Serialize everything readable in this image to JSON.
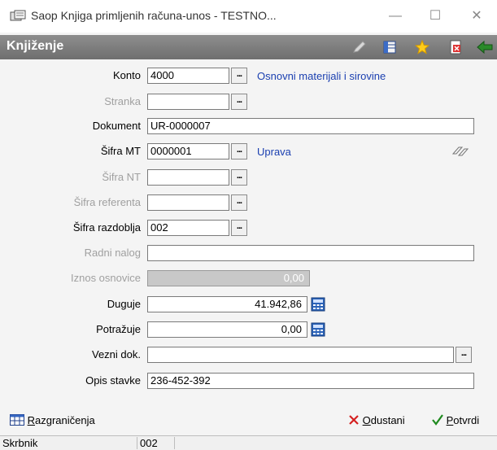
{
  "window": {
    "title": "Saop Knjiga primljenih računa-unos - TESTNO...",
    "minimize": "—",
    "maximize": "☐",
    "close": "✕"
  },
  "header": {
    "title": "Knjiženje"
  },
  "form": {
    "konto": {
      "label": "Konto",
      "value": "4000",
      "desc": "Osnovni materijali i sirovine"
    },
    "stranka": {
      "label": "Stranka",
      "value": ""
    },
    "dokument": {
      "label": "Dokument",
      "value": "UR-0000007"
    },
    "sifra_mt": {
      "label": "Šifra MT",
      "value": "0000001",
      "desc": "Uprava"
    },
    "sifra_nt": {
      "label": "Šifra NT",
      "value": ""
    },
    "sifra_referenta": {
      "label": "Šifra referenta",
      "value": ""
    },
    "sifra_razdoblja": {
      "label": "Šifra razdoblja",
      "value": "002"
    },
    "radni_nalog": {
      "label": "Radni nalog",
      "value": ""
    },
    "iznos_osnovice": {
      "label": "Iznos osnovice",
      "value": "0,00"
    },
    "duguje": {
      "label": "Duguje",
      "value": "41.942,86"
    },
    "potrazuje": {
      "label": "Potražuje",
      "value": "0,00"
    },
    "vezni_dok": {
      "label": "Vezni dok.",
      "value": ""
    },
    "opis_stavke": {
      "label": "Opis stavke",
      "value": "236-452-392"
    },
    "dots": "..."
  },
  "footer": {
    "razgranicenja_first": "R",
    "razgranicenja_rest": "azgraničenja",
    "odustani_first": "O",
    "odustani_rest": "dustani",
    "potvrdi_first": "P",
    "potvrdi_rest": "otvrdi"
  },
  "status": {
    "user": "Skrbnik",
    "code": "002",
    "empty": ""
  }
}
